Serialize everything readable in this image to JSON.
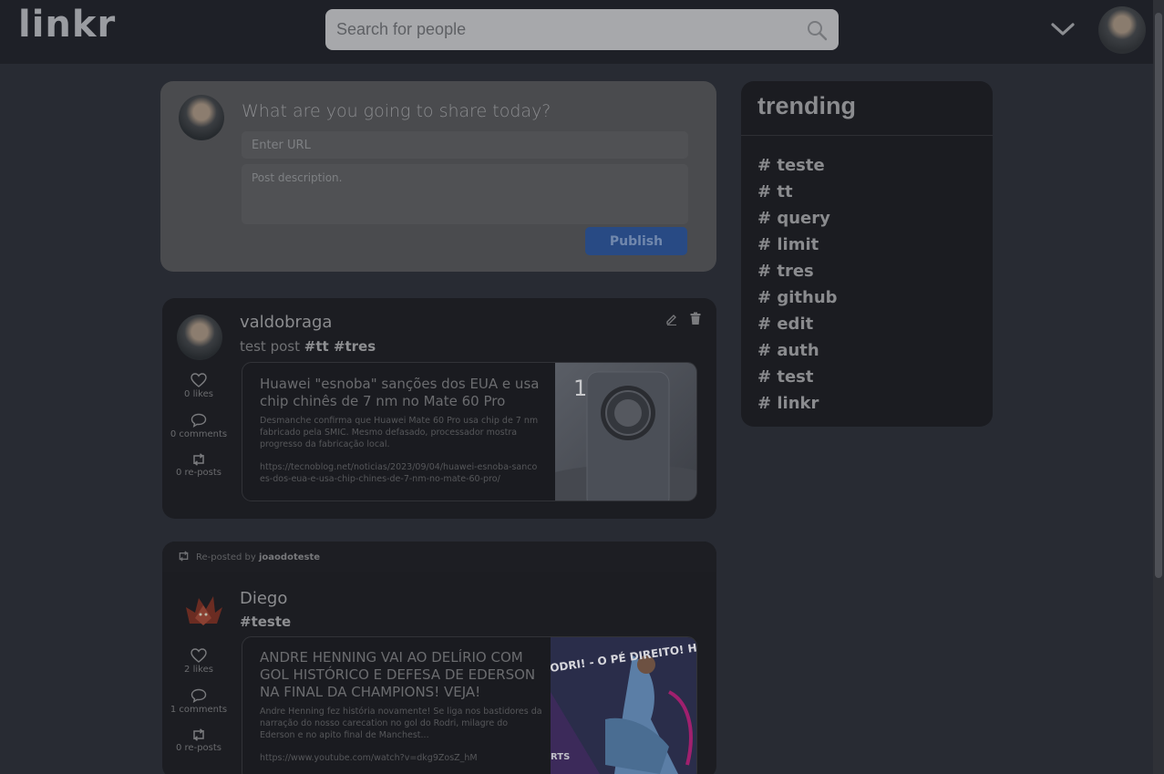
{
  "header": {
    "logo": "linkr",
    "search_placeholder": "Search for people"
  },
  "publish": {
    "question": "What are you going to share today?",
    "url_placeholder": "Enter URL",
    "description_placeholder": "Post description.",
    "button_label": "Publish"
  },
  "posts": [
    {
      "username": "valdobraga",
      "text": "test post",
      "tags": "#tt #tres",
      "likes": "0 likes",
      "comments": "0 comments",
      "reposts": "0 re-posts",
      "link": {
        "title": "Huawei \"esnoba\" sanções dos EUA e usa chip chinês de 7 nm no Mate 60 Pro",
        "description": "Desmanche confirma que Huawei Mate 60 Pro usa chip de 7 nm fabricado pela SMIC. Mesmo defasado, processador mostra progresso da fabricação local.",
        "url": "https://tecnoblog.net/noticias/2023/09/04/huawei-esnoba-sancoes-dos-eua-e-usa-chip-chines-de-7-nm-no-mate-60-pro/",
        "image_number": "1"
      }
    },
    {
      "repost_prefix": "Re-posted by",
      "repost_user": "joaodoteste",
      "username": "Diego",
      "text": "",
      "tags": "#teste",
      "likes": "2 likes",
      "comments": "1 comments",
      "reposts": "0 re-posts",
      "link": {
        "title": "ANDRE HENNING VAI AO DELÍRIO COM GOL HISTÓRICO E DEFESA DE EDERSON NA FINAL DA CHAMPIONS! VEJA!",
        "description": "Andre Henning fez história novamente! Se liga nos bastidores da narração do nosso carecation no gol do Rodri, milagre do Ederson e no apito final de Manchest...",
        "url": "https://www.youtube.com/watch?v=dkg9ZosZ_hM",
        "image_text": "ODRI! - O PÉ DIREITO! HISTÓRICO!",
        "image_brand": "RTS"
      }
    }
  ],
  "trending": {
    "title": "trending",
    "hashtags": [
      "# teste",
      "# tt",
      "# query",
      "# limit",
      "# tres",
      "# github",
      "# edit",
      "# auth",
      "# test",
      "# linkr"
    ]
  }
}
